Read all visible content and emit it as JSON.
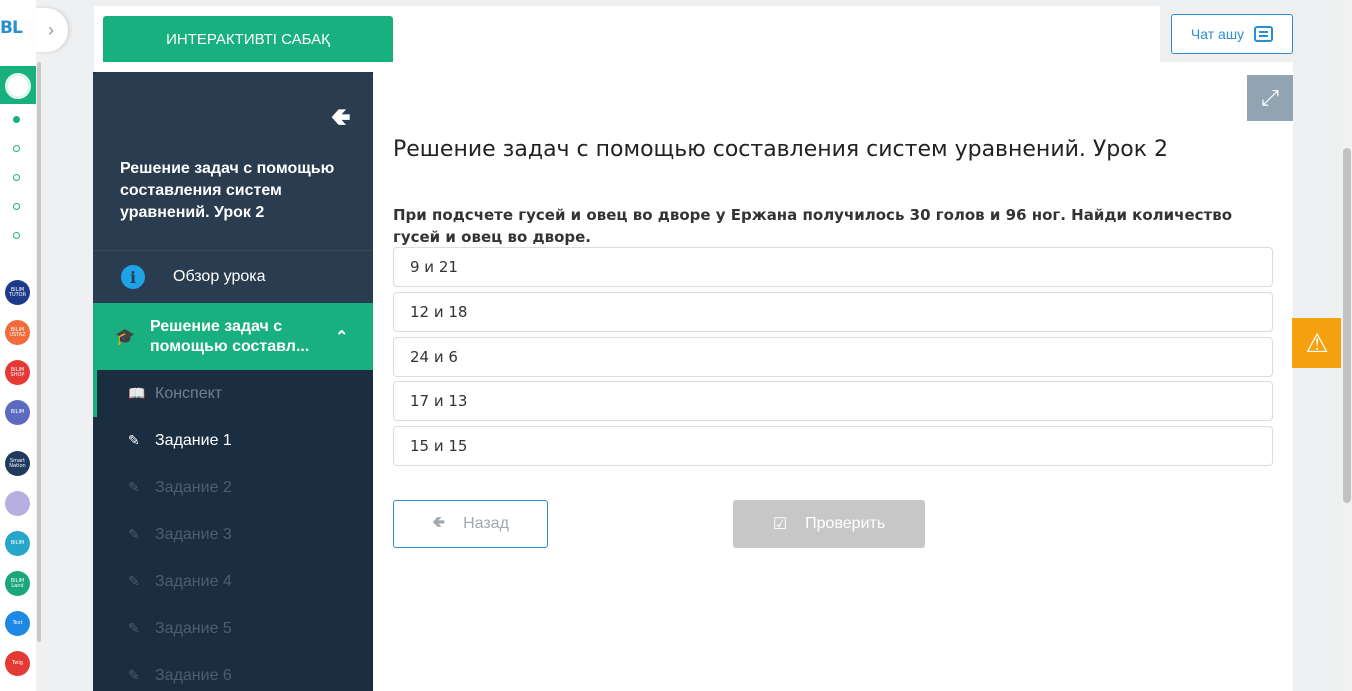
{
  "rail": {
    "logo": "BL",
    "apps": [
      {
        "name": "bilim-tutor",
        "label": "BILIM TUTOR",
        "color": "#1e3a8a"
      },
      {
        "name": "bilim-ustaz",
        "label": "BILIM USTAZ",
        "color": "#f26b3a"
      },
      {
        "name": "bilim-shop",
        "label": "BILIM SHOP",
        "color": "#e53935"
      },
      {
        "name": "bilim-books",
        "label": "BILIM",
        "color": "#5c6bc0"
      },
      {
        "name": "smart-nation",
        "label": "Smart Nation",
        "color": "#1e3a5f"
      },
      {
        "name": "bilim-cards",
        "label": "",
        "color": "#b5b0e0"
      },
      {
        "name": "bilim-media",
        "label": "BILIM",
        "color": "#26a6c9"
      },
      {
        "name": "bilim-land",
        "label": "BILIM Land",
        "color": "#1aa57a"
      },
      {
        "name": "bilim-test",
        "label": "Test",
        "color": "#1e88e5"
      },
      {
        "name": "twig",
        "label": "Twig",
        "color": "#e53935"
      }
    ]
  },
  "header": {
    "tab_label": "ИНТЕРАКТИВТІ САБАҚ",
    "chat_label": "Чат ашу"
  },
  "sidebar": {
    "title": "Решение задач с помощью составления систем уравнений. Урок 2",
    "overview_label": "Обзор урока",
    "section_label": "Решение задач с помощью составл...",
    "items": [
      {
        "label": "Конспект",
        "icon": "book-icon"
      },
      {
        "label": "Задание 1",
        "icon": "edit-icon"
      },
      {
        "label": "Задание 2",
        "icon": "edit-icon"
      },
      {
        "label": "Задание 3",
        "icon": "edit-icon"
      },
      {
        "label": "Задание 4",
        "icon": "edit-icon"
      },
      {
        "label": "Задание 5",
        "icon": "edit-icon"
      },
      {
        "label": "Задание 6",
        "icon": "edit-icon"
      }
    ]
  },
  "main": {
    "title": "Решение задач с помощью составления систем уравнений. Урок 2",
    "question": "При подсчете гусей и овец во дворе у Ержана получилось 30 голов и 96 ног. Найди количество гусей и овец во дворе.",
    "options": [
      "9 и 21",
      "12 и 18",
      "24 и 6",
      "17 и 13",
      "15 и 15"
    ],
    "back_label": "Назад",
    "check_label": "Проверить"
  },
  "colors": {
    "accent": "#19b080",
    "sidebar_bg": "#1b2d41",
    "link": "#2b8fcf",
    "warning": "#f5a00f"
  }
}
